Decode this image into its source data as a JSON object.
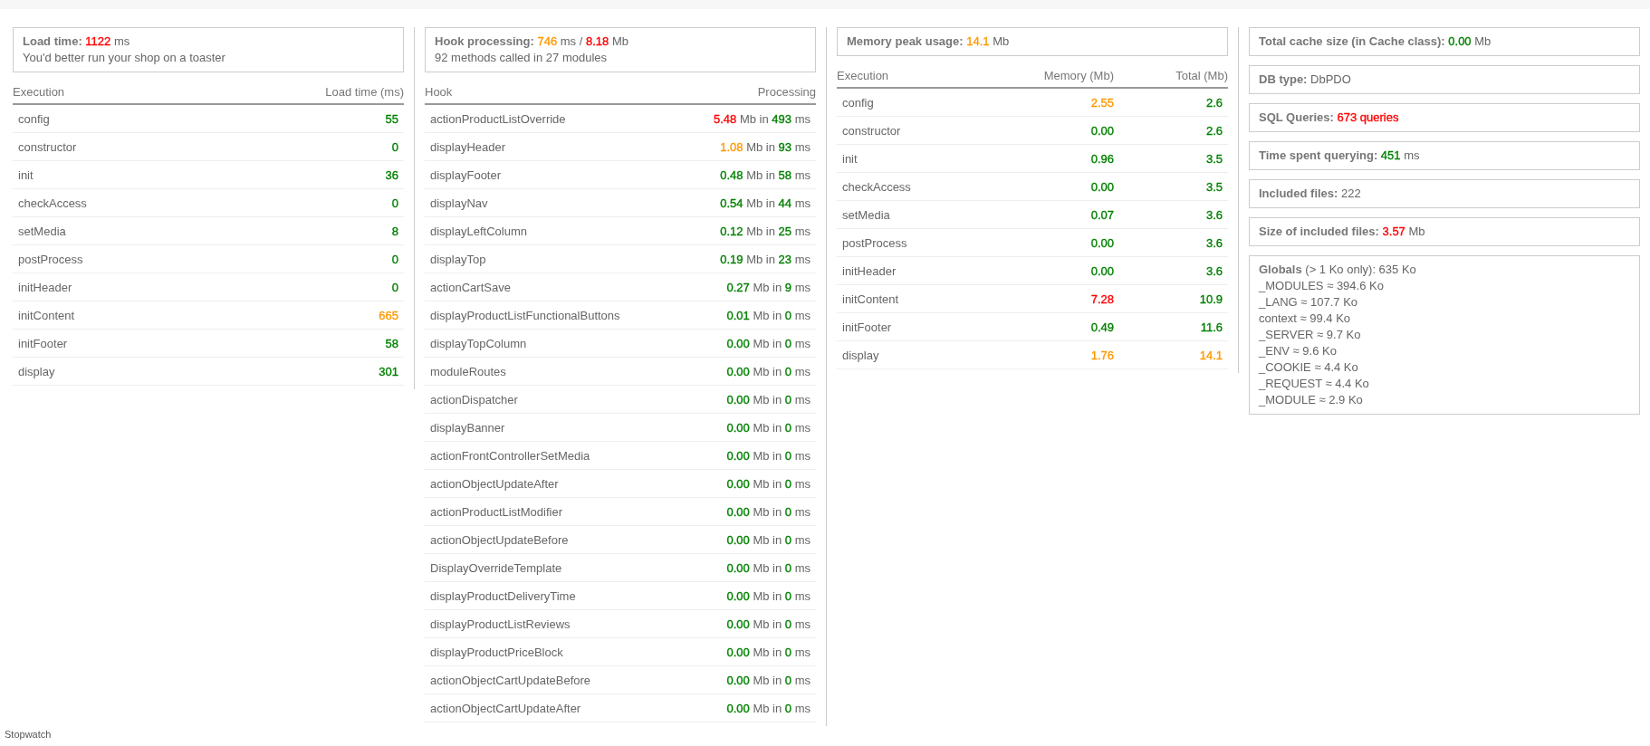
{
  "panels": [
    {
      "kind": "table",
      "summary": {
        "label": "Load time:",
        "parts": [
          {
            "text": "1122",
            "color": "#ff0000"
          },
          {
            "text": "ms"
          }
        ],
        "note": "You'd better run your shop on a toaster"
      },
      "columns": [
        "Execution",
        "Load time (ms)"
      ],
      "rows": [
        {
          "cells": [
            "config",
            [
              {
                "text": "55",
                "color": "#008000"
              }
            ]
          ]
        },
        {
          "cells": [
            "constructor",
            [
              {
                "text": "0",
                "color": "#008000"
              }
            ]
          ]
        },
        {
          "cells": [
            "init",
            [
              {
                "text": "36",
                "color": "#008000"
              }
            ]
          ]
        },
        {
          "cells": [
            "checkAccess",
            [
              {
                "text": "0",
                "color": "#008000"
              }
            ]
          ]
        },
        {
          "cells": [
            "setMedia",
            [
              {
                "text": "8",
                "color": "#008000"
              }
            ]
          ]
        },
        {
          "cells": [
            "postProcess",
            [
              {
                "text": "0",
                "color": "#008000"
              }
            ]
          ]
        },
        {
          "cells": [
            "initHeader",
            [
              {
                "text": "0",
                "color": "#008000"
              }
            ]
          ]
        },
        {
          "cells": [
            "initContent",
            [
              {
                "text": "665",
                "color": "#ff9900"
              }
            ]
          ]
        },
        {
          "cells": [
            "initFooter",
            [
              {
                "text": "58",
                "color": "#008000"
              }
            ]
          ]
        },
        {
          "cells": [
            "display",
            [
              {
                "text": "301",
                "color": "#008000"
              }
            ]
          ]
        }
      ]
    },
    {
      "kind": "table",
      "summary": {
        "label": "Hook processing:",
        "parts": [
          {
            "text": "746",
            "color": "#ff9900"
          },
          {
            "text": "ms /"
          },
          {
            "text": "8.18",
            "color": "#ff0000"
          },
          {
            "text": "Mb"
          }
        ],
        "note": "92 methods called in 27 modules"
      },
      "columns": [
        "Hook",
        "Processing"
      ],
      "rows": [
        {
          "cells": [
            "actionProductListOverride",
            [
              {
                "text": "5.48",
                "color": "#ff0000"
              },
              {
                "text": "Mb in"
              },
              {
                "text": "493",
                "color": "#008000"
              },
              {
                "text": "ms"
              }
            ]
          ]
        },
        {
          "cells": [
            "displayHeader",
            [
              {
                "text": "1.08",
                "color": "#ff9900"
              },
              {
                "text": "Mb in"
              },
              {
                "text": "93",
                "color": "#008000"
              },
              {
                "text": "ms"
              }
            ]
          ]
        },
        {
          "cells": [
            "displayFooter",
            [
              {
                "text": "0.48",
                "color": "#008000"
              },
              {
                "text": "Mb in"
              },
              {
                "text": "58",
                "color": "#008000"
              },
              {
                "text": "ms"
              }
            ]
          ]
        },
        {
          "cells": [
            "displayNav",
            [
              {
                "text": "0.54",
                "color": "#008000"
              },
              {
                "text": "Mb in"
              },
              {
                "text": "44",
                "color": "#008000"
              },
              {
                "text": "ms"
              }
            ]
          ]
        },
        {
          "cells": [
            "displayLeftColumn",
            [
              {
                "text": "0.12",
                "color": "#008000"
              },
              {
                "text": "Mb in"
              },
              {
                "text": "25",
                "color": "#008000"
              },
              {
                "text": "ms"
              }
            ]
          ]
        },
        {
          "cells": [
            "displayTop",
            [
              {
                "text": "0.19",
                "color": "#008000"
              },
              {
                "text": "Mb in"
              },
              {
                "text": "23",
                "color": "#008000"
              },
              {
                "text": "ms"
              }
            ]
          ]
        },
        {
          "cells": [
            "actionCartSave",
            [
              {
                "text": "0.27",
                "color": "#008000"
              },
              {
                "text": "Mb in"
              },
              {
                "text": "9",
                "color": "#008000"
              },
              {
                "text": "ms"
              }
            ]
          ]
        },
        {
          "cells": [
            "displayProductListFunctionalButtons",
            [
              {
                "text": "0.01",
                "color": "#008000"
              },
              {
                "text": "Mb in"
              },
              {
                "text": "0",
                "color": "#008000"
              },
              {
                "text": "ms"
              }
            ]
          ]
        },
        {
          "cells": [
            "displayTopColumn",
            [
              {
                "text": "0.00",
                "color": "#008000"
              },
              {
                "text": "Mb in"
              },
              {
                "text": "0",
                "color": "#008000"
              },
              {
                "text": "ms"
              }
            ]
          ]
        },
        {
          "cells": [
            "moduleRoutes",
            [
              {
                "text": "0.00",
                "color": "#008000"
              },
              {
                "text": "Mb in"
              },
              {
                "text": "0",
                "color": "#008000"
              },
              {
                "text": "ms"
              }
            ]
          ]
        },
        {
          "cells": [
            "actionDispatcher",
            [
              {
                "text": "0.00",
                "color": "#008000"
              },
              {
                "text": "Mb in"
              },
              {
                "text": "0",
                "color": "#008000"
              },
              {
                "text": "ms"
              }
            ]
          ]
        },
        {
          "cells": [
            "displayBanner",
            [
              {
                "text": "0.00",
                "color": "#008000"
              },
              {
                "text": "Mb in"
              },
              {
                "text": "0",
                "color": "#008000"
              },
              {
                "text": "ms"
              }
            ]
          ]
        },
        {
          "cells": [
            "actionFrontControllerSetMedia",
            [
              {
                "text": "0.00",
                "color": "#008000"
              },
              {
                "text": "Mb in"
              },
              {
                "text": "0",
                "color": "#008000"
              },
              {
                "text": "ms"
              }
            ]
          ]
        },
        {
          "cells": [
            "actionObjectUpdateAfter",
            [
              {
                "text": "0.00",
                "color": "#008000"
              },
              {
                "text": "Mb in"
              },
              {
                "text": "0",
                "color": "#008000"
              },
              {
                "text": "ms"
              }
            ]
          ]
        },
        {
          "cells": [
            "actionProductListModifier",
            [
              {
                "text": "0.00",
                "color": "#008000"
              },
              {
                "text": "Mb in"
              },
              {
                "text": "0",
                "color": "#008000"
              },
              {
                "text": "ms"
              }
            ]
          ]
        },
        {
          "cells": [
            "actionObjectUpdateBefore",
            [
              {
                "text": "0.00",
                "color": "#008000"
              },
              {
                "text": "Mb in"
              },
              {
                "text": "0",
                "color": "#008000"
              },
              {
                "text": "ms"
              }
            ]
          ]
        },
        {
          "cells": [
            "DisplayOverrideTemplate",
            [
              {
                "text": "0.00",
                "color": "#008000"
              },
              {
                "text": "Mb in"
              },
              {
                "text": "0",
                "color": "#008000"
              },
              {
                "text": "ms"
              }
            ]
          ]
        },
        {
          "cells": [
            "displayProductDeliveryTime",
            [
              {
                "text": "0.00",
                "color": "#008000"
              },
              {
                "text": "Mb in"
              },
              {
                "text": "0",
                "color": "#008000"
              },
              {
                "text": "ms"
              }
            ]
          ]
        },
        {
          "cells": [
            "displayProductListReviews",
            [
              {
                "text": "0.00",
                "color": "#008000"
              },
              {
                "text": "Mb in"
              },
              {
                "text": "0",
                "color": "#008000"
              },
              {
                "text": "ms"
              }
            ]
          ]
        },
        {
          "cells": [
            "displayProductPriceBlock",
            [
              {
                "text": "0.00",
                "color": "#008000"
              },
              {
                "text": "Mb in"
              },
              {
                "text": "0",
                "color": "#008000"
              },
              {
                "text": "ms"
              }
            ]
          ]
        },
        {
          "cells": [
            "actionObjectCartUpdateBefore",
            [
              {
                "text": "0.00",
                "color": "#008000"
              },
              {
                "text": "Mb in"
              },
              {
                "text": "0",
                "color": "#008000"
              },
              {
                "text": "ms"
              }
            ]
          ]
        },
        {
          "cells": [
            "actionObjectCartUpdateAfter",
            [
              {
                "text": "0.00",
                "color": "#008000"
              },
              {
                "text": "Mb in"
              },
              {
                "text": "0",
                "color": "#008000"
              },
              {
                "text": "ms"
              }
            ]
          ]
        }
      ]
    },
    {
      "kind": "table",
      "summary": {
        "label": "Memory peak usage:",
        "parts": [
          {
            "text": "14.1",
            "color": "#ff9900"
          },
          {
            "text": "Mb"
          }
        ]
      },
      "columns": [
        "Execution",
        "Memory (Mb)",
        "Total (Mb)"
      ],
      "rows": [
        {
          "cells": [
            "config",
            [
              {
                "text": "2.55",
                "color": "#ff9900"
              }
            ],
            [
              {
                "text": "2.6",
                "color": "#008000"
              }
            ]
          ]
        },
        {
          "cells": [
            "constructor",
            [
              {
                "text": "0.00",
                "color": "#008000"
              }
            ],
            [
              {
                "text": "2.6",
                "color": "#008000"
              }
            ]
          ]
        },
        {
          "cells": [
            "init",
            [
              {
                "text": "0.96",
                "color": "#008000"
              }
            ],
            [
              {
                "text": "3.5",
                "color": "#008000"
              }
            ]
          ]
        },
        {
          "cells": [
            "checkAccess",
            [
              {
                "text": "0.00",
                "color": "#008000"
              }
            ],
            [
              {
                "text": "3.5",
                "color": "#008000"
              }
            ]
          ]
        },
        {
          "cells": [
            "setMedia",
            [
              {
                "text": "0.07",
                "color": "#008000"
              }
            ],
            [
              {
                "text": "3.6",
                "color": "#008000"
              }
            ]
          ]
        },
        {
          "cells": [
            "postProcess",
            [
              {
                "text": "0.00",
                "color": "#008000"
              }
            ],
            [
              {
                "text": "3.6",
                "color": "#008000"
              }
            ]
          ]
        },
        {
          "cells": [
            "initHeader",
            [
              {
                "text": "0.00",
                "color": "#008000"
              }
            ],
            [
              {
                "text": "3.6",
                "color": "#008000"
              }
            ]
          ]
        },
        {
          "cells": [
            "initContent",
            [
              {
                "text": "7.28",
                "color": "#ff0000"
              }
            ],
            [
              {
                "text": "10.9",
                "color": "#008000"
              }
            ]
          ]
        },
        {
          "cells": [
            "initFooter",
            [
              {
                "text": "0.49",
                "color": "#008000"
              }
            ],
            [
              {
                "text": "11.6",
                "color": "#008000"
              }
            ]
          ]
        },
        {
          "cells": [
            "display",
            [
              {
                "text": "1.76",
                "color": "#ff9900"
              }
            ],
            [
              {
                "text": "14.1",
                "color": "#ff9900"
              }
            ]
          ]
        }
      ]
    },
    {
      "kind": "info",
      "boxes": [
        {
          "label": "Total cache size (in Cache class):",
          "parts": [
            {
              "text": "0.00",
              "color": "#008000"
            },
            {
              "text": "Mb"
            }
          ]
        },
        {
          "label": "DB type:",
          "parts": [
            {
              "text": "DbPDO"
            }
          ]
        },
        {
          "label": "SQL Queries:",
          "parts": [
            {
              "text": "673 queries",
              "color": "#ff0000"
            }
          ]
        },
        {
          "label": "Time spent querying:",
          "parts": [
            {
              "text": "451",
              "color": "#008000"
            },
            {
              "text": "ms"
            }
          ]
        },
        {
          "label": "Included files:",
          "parts": [
            {
              "text": "222"
            }
          ]
        },
        {
          "label": "Size of included files:",
          "parts": [
            {
              "text": "3.57",
              "color": "#ff0000"
            },
            {
              "text": "Mb"
            }
          ]
        },
        {
          "label": "Globals",
          "parts": [
            {
              "text": "(> 1 Ko only): 635 Ko"
            }
          ],
          "lines": [
            "_MODULES ≈ 394.6 Ko",
            "_LANG ≈ 107.7 Ko",
            "context ≈ 99.4 Ko",
            "_SERVER ≈ 9.7 Ko",
            "_ENV ≈ 9.6 Ko",
            "_COOKIE ≈ 4.4 Ko",
            "_REQUEST ≈ 4.4 Ko",
            "_MODULE ≈ 2.9 Ko"
          ]
        }
      ]
    }
  ],
  "footer": "Stopwatch"
}
